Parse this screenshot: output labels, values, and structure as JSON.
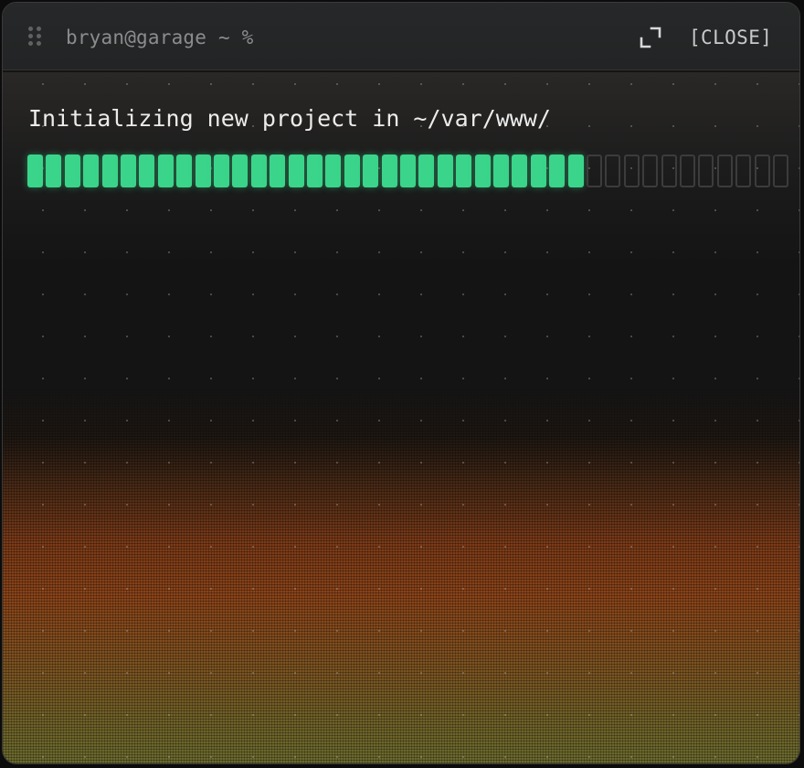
{
  "window": {
    "title": "bryan@garage ~ %",
    "close_label": "[CLOSE]"
  },
  "icons": {
    "drag": "drag-handle-icon",
    "expand": "expand-icon"
  },
  "terminal": {
    "message": "Initializing new project in ~/var/www/",
    "progress": {
      "filled_segments": 30,
      "total_segments": 41,
      "fraction": 0.73
    }
  },
  "colors": {
    "progress_fill": "#3ad58a",
    "progress_empty_border": "#3c3c3c",
    "text": "#ececec",
    "title_text": "#8a8c8e"
  }
}
